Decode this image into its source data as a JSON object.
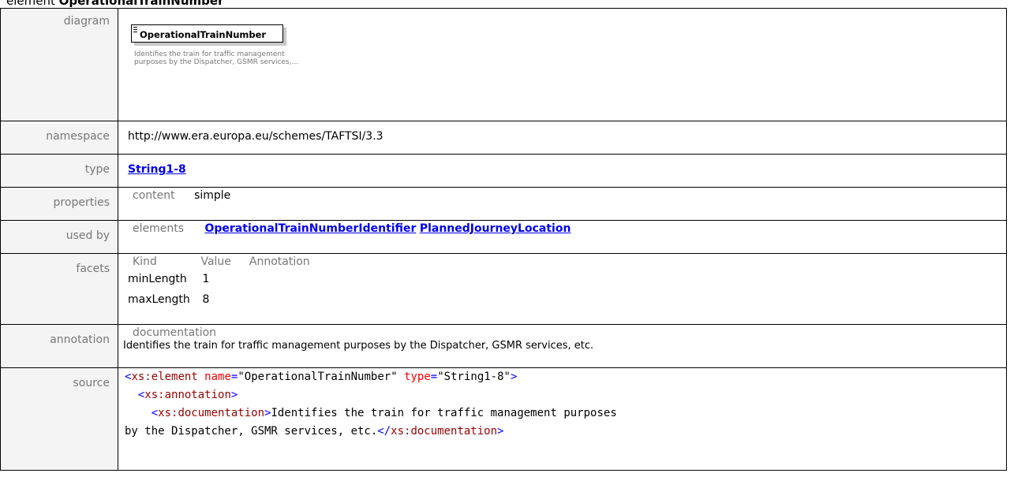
{
  "heading": {
    "prefix": "element",
    "name": "OperationalTrainNumber"
  },
  "labels": {
    "diagram": "diagram",
    "namespace": "namespace",
    "type": "type",
    "properties": "properties",
    "used_by": "used by",
    "facets": "facets",
    "annotation": "annotation",
    "source": "source"
  },
  "diagram": {
    "box_title": "OperationalTrainNumber",
    "doc_text": "Identifies the train for traffic management purposes by the Dispatcher, GSMR services,..."
  },
  "namespace": "http://www.era.europa.eu/schemes/TAFTSI/3.3",
  "type": "String1-8",
  "properties": {
    "label": "content",
    "value": "simple"
  },
  "used_by": {
    "label": "elements",
    "items": [
      "OperationalTrainNumberIdentifier",
      "PlannedJourneyLocation"
    ]
  },
  "facets": {
    "headers": [
      "Kind",
      "Value",
      "Annotation"
    ],
    "rows": [
      {
        "kind": "minLength",
        "value": "1"
      },
      {
        "kind": "maxLength",
        "value": "8"
      }
    ]
  },
  "annotation": {
    "label": "documentation",
    "text": "Identifies the train for traffic management purposes by the Dispatcher, GSMR services, etc."
  },
  "source": {
    "open_bracket": "<",
    "close_bracket": ">",
    "end_open": "</",
    "line1_tag": "xs:element",
    "attr_name": "name",
    "attr_name_value": "OperationalTrainNumber",
    "attr_type": "type",
    "attr_type_value": "String1-8",
    "line2_tag": "xs:annotation",
    "line3_tag": "xs:documentation",
    "doc_text_part1": "Identifies the train for traffic management purposes",
    "doc_text_part2": "by the Dispatcher, GSMR services, etc."
  }
}
